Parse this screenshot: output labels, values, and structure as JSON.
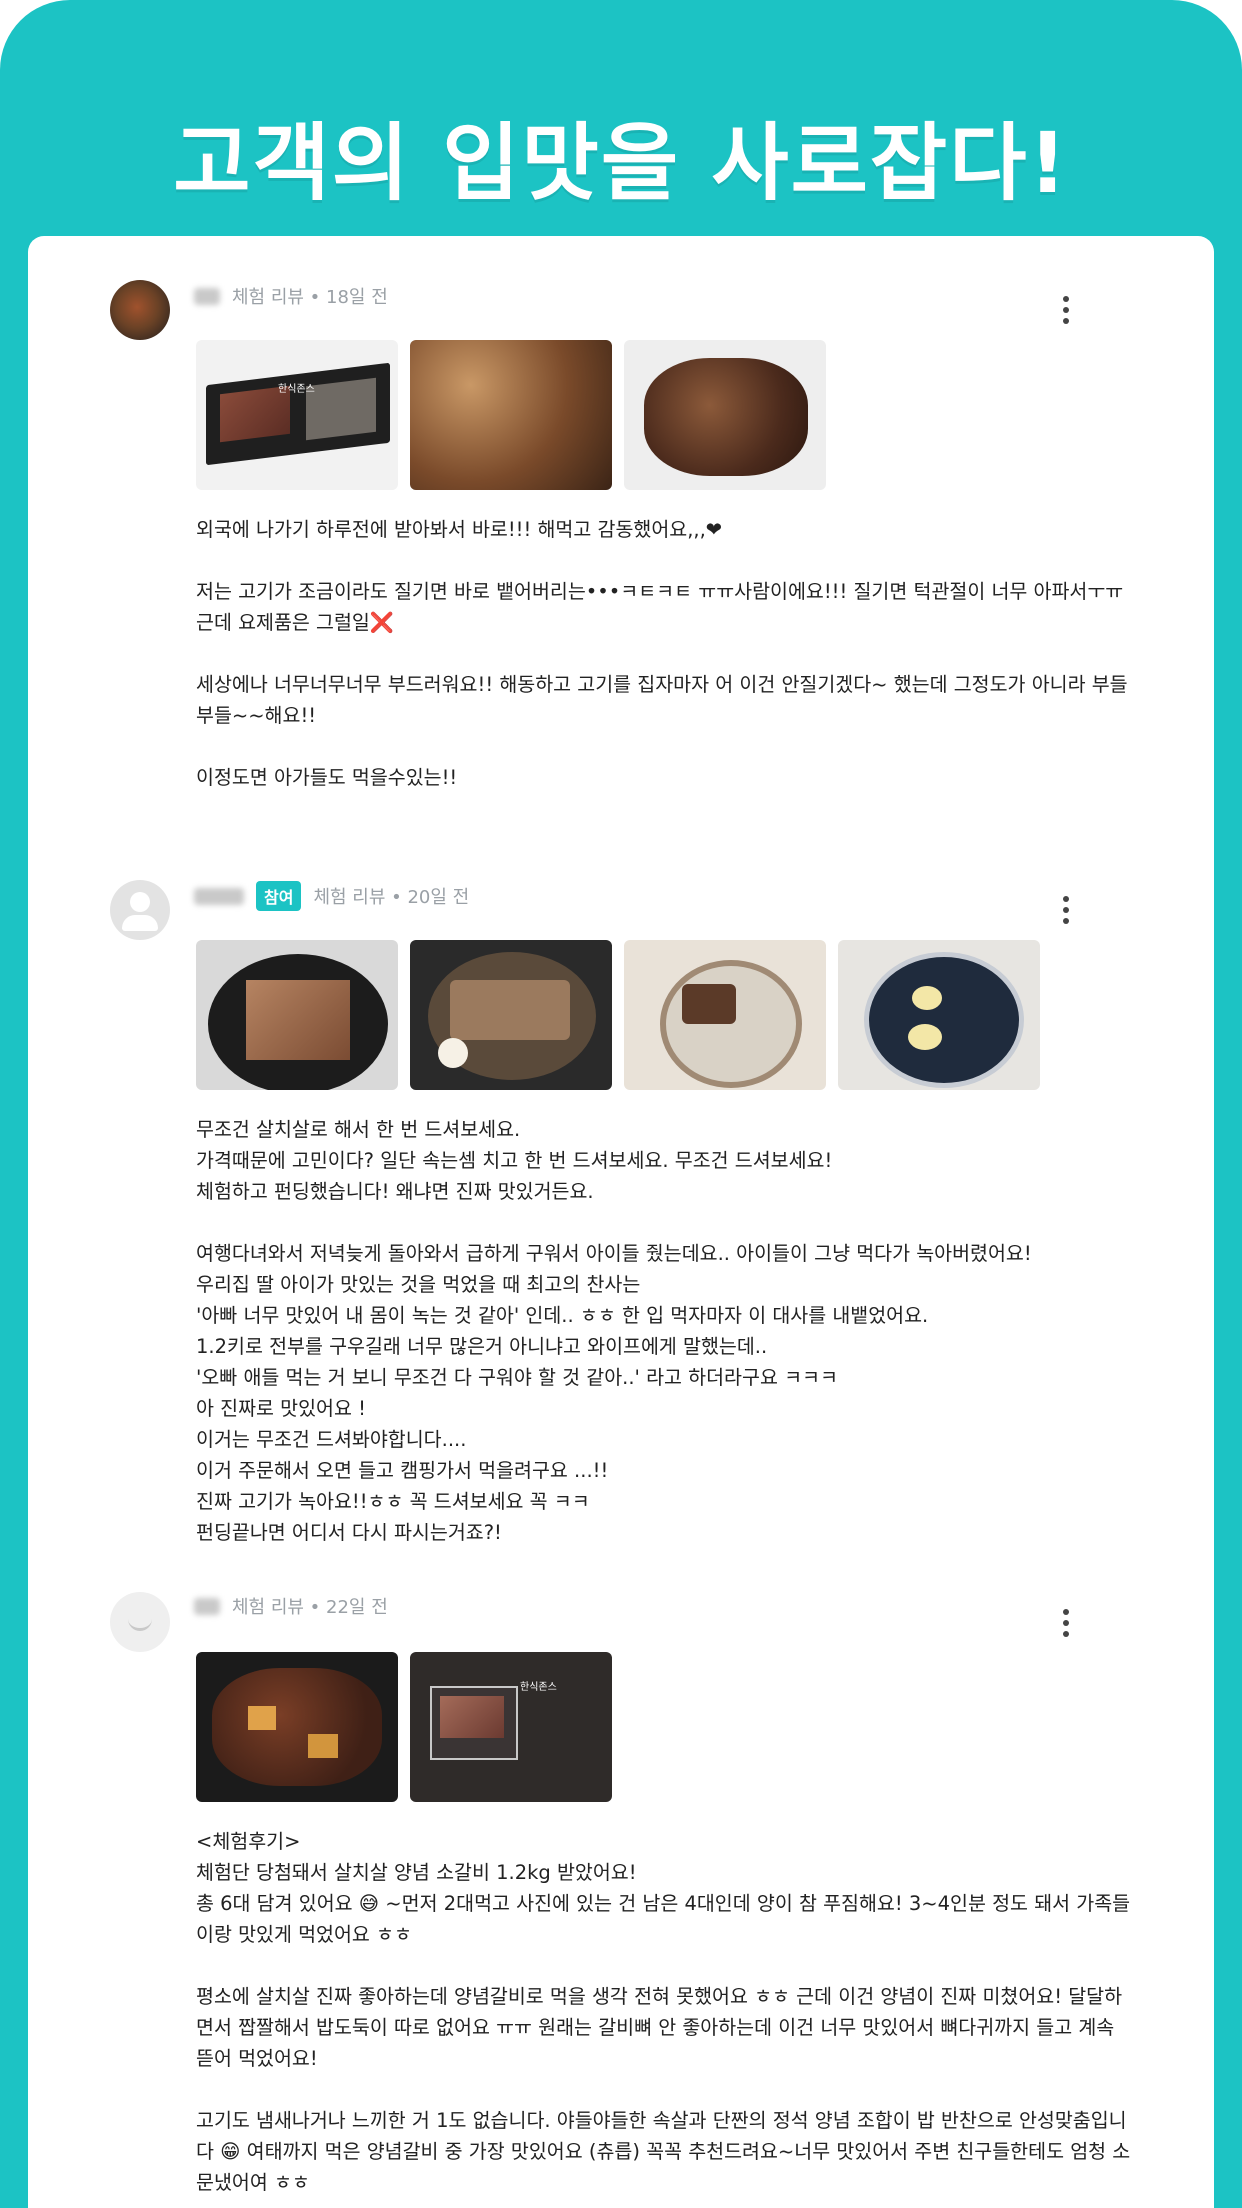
{
  "headline": "고객의 입맛을 사로잡다!",
  "reviews": [
    {
      "meta_text": "체험 리뷰 • 18일 전",
      "participation_badge": "",
      "text": "외국에 나가기 하루전에 받아봐서 바로!!! 해먹고 감동했어요,,,❤\n\n저는 고기가 조금이라도 질기면 바로 뱉어버리는•••ㅋㅌㅋㅌ ㅠㅠ사람이에요!!! 질기면 턱관절이 너무 아파서ㅜㅠ\n근데 요제품은 그럴일❌\n\n세상에나 너무너무너무 부드러워요!! 해동하고 고기를 집자마자 어 이건 안질기겠다~ 했는데 그정도가 아니라 부들부들~~해요!!\n\n이정도면 아가들도 먹을수있는!!"
    },
    {
      "meta_text": "체험 리뷰 • 20일 전",
      "participation_badge": "참여",
      "text": "무조건 살치살로 해서 한 번 드셔보세요.\n가격때문에 고민이다? 일단 속는셈 치고 한 번 드셔보세요. 무조건 드셔보세요!\n체험하고 펀딩했습니다! 왜냐면 진짜 맛있거든요.\n\n여행다녀와서 저녁늦게 돌아와서 급하게 구워서 아이들 줬는데요.. 아이들이 그냥 먹다가 녹아버렸어요!\n우리집 딸 아이가 맛있는 것을 먹었을 때 최고의 찬사는\n'아빠 너무 맛있어 내 몸이 녹는 것 같아' 인데.. ㅎㅎ 한 입 먹자마자 이 대사를 내뱉었어요.\n1.2키로 전부를 구우길래 너무 많은거 아니냐고 와이프에게 말했는데..\n'오빠 애들 먹는 거 보니 무조건 다 구워야 할 것 같아..' 라고 하더라구요 ㅋㅋㅋ\n아 진짜로 맛있어요 !\n이거는 무조건 드셔봐야합니다....\n이거 주문해서 오면 들고 캠핑가서 먹을려구요 ...!!\n진짜 고기가 녹아요!!ㅎㅎ 꼭 드셔보세요 꼭 ㅋㅋ\n펀딩끝나면 어디서 다시 파시는거죠?!"
    },
    {
      "meta_text": "체험 리뷰 • 22일 전",
      "participation_badge": "",
      "text": "<체험후기>\n체험단 당첨돼서 살치살 양념 소갈비 1.2kg 받았어요!\n총 6대 담겨 있어요 😅 ~먼저 2대먹고 사진에 있는 건 남은 4대인데 양이 참 푸짐해요! 3~4인분 정도 돼서 가족들이랑 맛있게 먹었어요 ㅎㅎ\n\n평소에 살치살 진짜 좋아하는데 양념갈비로 먹을 생각 전혀 못했어요 ㅎㅎ 근데 이건 양념이 진짜 미쳤어요! 달달하면서 짭짤해서 밥도둑이 따로 없어요 ㅠㅠ 원래는 갈비뼈 안 좋아하는데 이건 너무 맛있어서 뼈다귀까지 들고 계속 뜯어 먹었어요!\n\n고기도 냄새나거나 느끼한 거 1도 없습니다. 야들야들한 속살과 단짠의 정석 양념 조합이 밥 반찬으로 안성맞춤입니다 😁 여태까지 먹은 양념갈비 중 가장 맛있어요 (츄릅) 꼭꼭 추천드려요~너무 맛있어서 주변 친구들한테도 엄청 소문냈어여 ㅎㅎ"
    }
  ],
  "package_labels": [
    "한식존스",
    "한식존스"
  ]
}
